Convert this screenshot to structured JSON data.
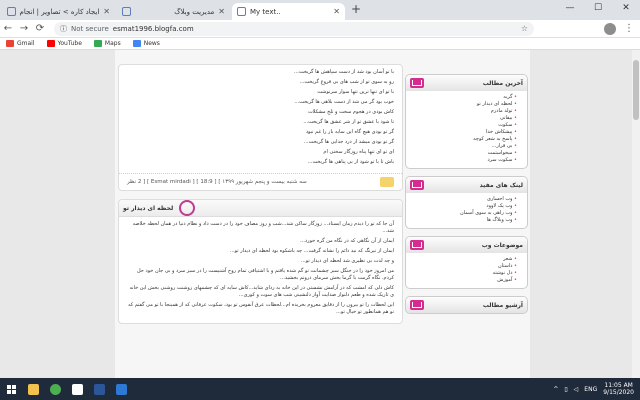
{
  "browser": {
    "tabs": [
      {
        "label": "ایجاد کاره > تصاویر | انجام مید"
      },
      {
        "label": "مدیریت وبلاگ"
      },
      {
        "label": "My text.."
      }
    ],
    "new_tab": "+",
    "window_controls": {
      "minimize": "—",
      "maximize": "☐",
      "close": "✕"
    },
    "nav": {
      "back": "←",
      "forward": "→",
      "reload": "⟳"
    },
    "security": "Not secure",
    "url": "esmat1996.blogfa.com",
    "bookmarks": [
      {
        "label": "Gmail",
        "color": "#ea4335"
      },
      {
        "label": "YouTube",
        "color": "#ff0000"
      },
      {
        "label": "Maps",
        "color": "#34a853"
      },
      {
        "label": "News",
        "color": "#4285f4"
      }
    ]
  },
  "post1": {
    "lines": [
      "با تو آسان بود شد از دست سپاهش ها گریخت...",
      "رو به سوی تو از شب های بی فروغ گریخت...",
      "با تو ای تنها ترین تنها سوار سرنوشت",
      "خوب بود گر می شد از دست بلاهی ها گریخت...",
      "کاش بودی در هجوم سخت و تلخ مشکلات",
      "تا شود با عشق تو از شر عشق ها گریخت...",
      "گر تو بودی هیچ گاه این سایه بار را غم نبود",
      "گر تو بودی میشد از درد جدایی ها گریخت...",
      "ای تو ای تنها پناه روزگار سختی ام",
      "باش تا با تو شود از بی پناهی ها گریخت..."
    ],
    "meta": "سه شنبه بیست و پنجم شهریور ۱۳۹۹ ] [ 18:9 ] [ Esmat mirdadi ] [ 2 نظر"
  },
  "post2": {
    "title": "لحظه ای دیدار تو",
    "lines": [
      "آن جا که تو را دیدم زمان ایستاد... روزگار ساکن شد...شب و روز مصاف خود را در دست داد و نظام دنیا در همان لحظه خلاصه شد...",
      "ایمان از آن نگاهی که در نگاه من گره خورد...",
      "ایمان از نیرنگ که نید ذائم را نشانه گرفت... چه باشکوه بود لحظه ای دیدار تو...",
      "و چه لذت بی نظیری شد لحظه ای دیدار تو...",
      "من امروز خود را در جنگل سبز چشمانت تو گم شده یافتم و با اشتیاقی تمام روح آشنیست را در سبز سرد و بی جان خود حل کردم. نگاه گرمت با گرما بخش سرمای درونم بخشید...",
      "کاش دلی که امشب که در آرامش نشستی در این خانه به ردای شاید...کاش سایه ای که چشمهای روشنت روشنی بخش این خانه ی تاریک شده و طعم دلنواز صدایت آواز دلنشینی شب های سوت و کوری...",
      "این لحظات را تو بیرون را از دقایق معروم بخریده ام...لحظات عرق آنفوس تو بود، سکوت عرفانی که از همینجا با تو می گفتم که تو هم همانطور تو خیال تو..."
    ]
  },
  "sidebar": {
    "boxes": [
      {
        "title": "آخرین مطالب",
        "items": [
          "گربه",
          "لحظه ای دیدار تو",
          "تولد مادرم",
          "بیقانی",
          "سکوت",
          "پیشکاش خدا",
          "پاسخ به شعر کوچه",
          "بی قرار...",
          "میخواستمت",
          "سکوت سرد"
        ]
      },
      {
        "title": "لینک های مفید",
        "items": [
          "وب احساری",
          "وب پک لاوود",
          "وب راهی به سوی آسمان",
          "وب وبلاگ ها"
        ]
      },
      {
        "title": "موضوعات وب",
        "items": [
          "شعر",
          "داستان",
          "دل نوشته",
          "آموزش"
        ]
      },
      {
        "title": "آرشیو مطالب",
        "items": []
      }
    ]
  },
  "taskbar": {
    "tray": {
      "lang": "ENG",
      "time": "11:05 AM",
      "date": "9/15/2020"
    },
    "apps": [
      {
        "name": "file-explorer-icon",
        "color": "#f2c14e"
      },
      {
        "name": "chrome-icon",
        "color": "#4caf50"
      },
      {
        "name": "mail-icon",
        "color": "#ffffff"
      },
      {
        "name": "word-icon",
        "color": "#2b579a"
      },
      {
        "name": "store-icon",
        "color": "#2d7ad6"
      }
    ]
  }
}
